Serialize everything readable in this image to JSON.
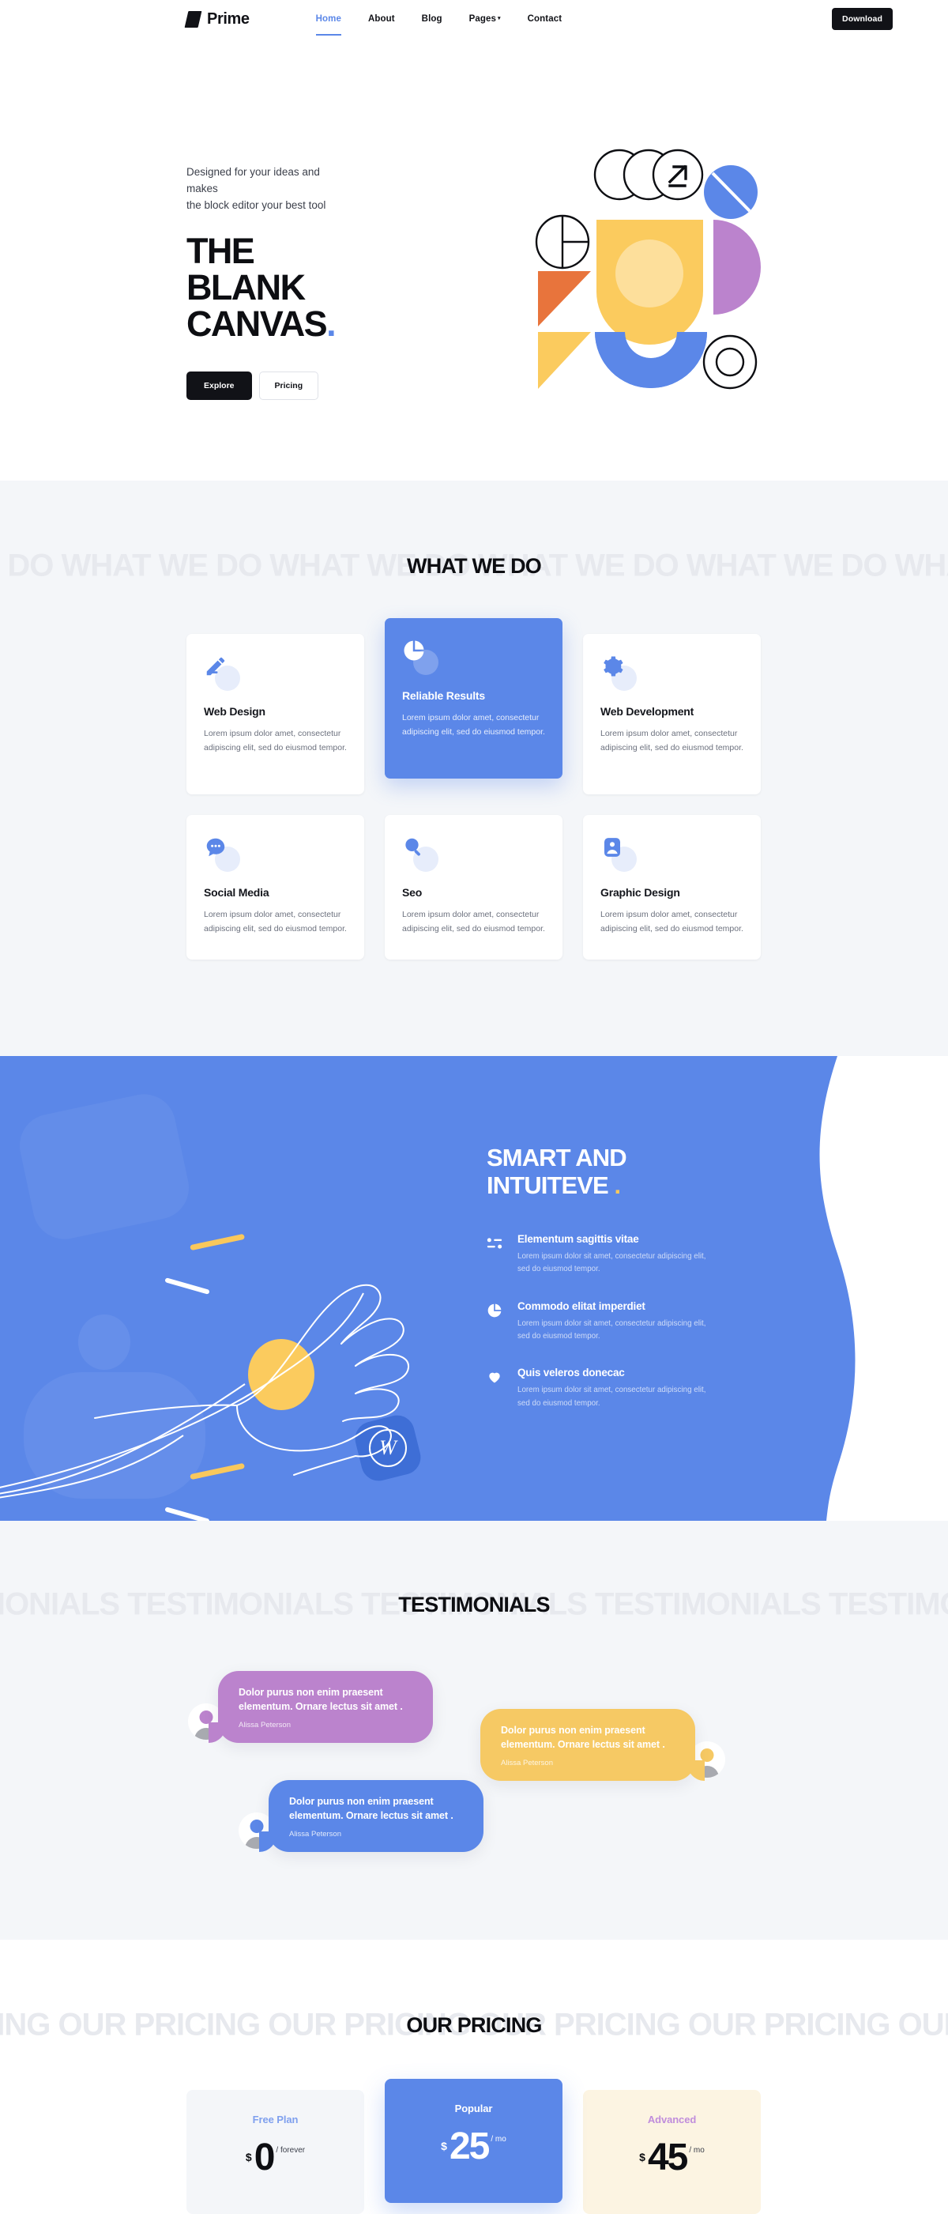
{
  "header": {
    "brand": "Prime",
    "nav": [
      {
        "label": "Home",
        "active": true,
        "caret": false
      },
      {
        "label": "About",
        "active": false,
        "caret": false
      },
      {
        "label": "Blog",
        "active": false,
        "caret": false
      },
      {
        "label": "Pages",
        "active": false,
        "caret": true
      },
      {
        "label": "Contact",
        "active": false,
        "caret": false
      }
    ],
    "download_label": "Download"
  },
  "hero": {
    "kicker_line1": "Designed for your ideas and makes",
    "kicker_line2": "the block editor your best tool",
    "title_line1": "THE BLANK",
    "title_line2": "CANVAS",
    "title_dot": ".",
    "explore_label": "Explore",
    "pricing_label": "Pricing"
  },
  "services": {
    "band_main": "WHAT WE DO",
    "band_ghost": "WHAT WE DO WHAT WE DO WHAT WE DO WHAT WE DO WHAT WE DO WHAT WE DO",
    "body": "Lorem ipsum dolor amet, consectetur adipiscing elit, sed do eiusmod tempor.",
    "cards": [
      {
        "title": "Web Design",
        "icon": "pencil-icon",
        "featured": false
      },
      {
        "title": "Reliable Results",
        "icon": "pie-chart-icon",
        "featured": true
      },
      {
        "title": "Web Development",
        "icon": "gear-icon",
        "featured": false
      },
      {
        "title": "Social Media",
        "icon": "chat-bubble-icon",
        "featured": false
      },
      {
        "title": "Seo",
        "icon": "magnifier-icon",
        "featured": false
      },
      {
        "title": "Graphic Design",
        "icon": "image-icon",
        "featured": false
      }
    ]
  },
  "smart": {
    "title_line1": "SMART AND",
    "title_line2": "INTUITEVE",
    "title_dot": ".",
    "features": [
      {
        "icon": "list-icon",
        "title": "Elementum sagittis vitae",
        "text": "Lorem ipsum dolor sit amet, consectetur adipiscing elit, sed do eiusmod tempor."
      },
      {
        "icon": "pie-chart-icon",
        "title": "Commodo elitat imperdiet",
        "text": "Lorem ipsum dolor sit amet, consectetur adipiscing elit, sed do eiusmod tempor."
      },
      {
        "icon": "heart-icon",
        "title": "Quis veleros donecac",
        "text": "Lorem ipsum dolor sit amet, consectetur adipiscing elit, sed do eiusmod tempor."
      }
    ],
    "illustration": "hand-holding-wordpress-icon"
  },
  "testimonials": {
    "band_main": "TESTIMONIALS",
    "band_ghost": "TESTIMONIALS TESTIMONIALS TESTIMONIALS TESTIMONIALS TESTIMONIALS",
    "items": [
      {
        "text": "Dolor purus non enim praesent elementum. Ornare lectus sit amet .",
        "author": "Alissa Peterson",
        "color": "#bb83cd",
        "align": "left"
      },
      {
        "text": "Dolor purus non enim praesent elementum. Ornare lectus sit amet .",
        "author": "Alissa Peterson",
        "color": "#f6c964",
        "align": "right"
      },
      {
        "text": "Dolor purus non enim praesent elementum. Ornare lectus sit amet .",
        "author": "Alissa Peterson",
        "color": "#5b87e8",
        "align": "left"
      }
    ]
  },
  "pricing": {
    "band_main": "OUR PRICING",
    "band_ghost": "OUR PRICING OUR PRICING OUR PRICING OUR PRICING OUR PRICING OUR PRICING",
    "plans": [
      {
        "name": "Free Plan",
        "currency": "$",
        "amount": "0",
        "period": "/ forever",
        "variant": "free"
      },
      {
        "name": "Popular",
        "currency": "$",
        "amount": "25",
        "period": "/ mo",
        "variant": "popular"
      },
      {
        "name": "Advanced",
        "currency": "$",
        "amount": "45",
        "period": "/ mo",
        "variant": "advanced"
      }
    ]
  },
  "colors": {
    "accent_blue": "#5b87e8",
    "yellow": "#f9c85c",
    "purple": "#bb83cd",
    "orange": "#e8743c",
    "dark": "#111217",
    "light_bg": "#f4f6f9"
  }
}
